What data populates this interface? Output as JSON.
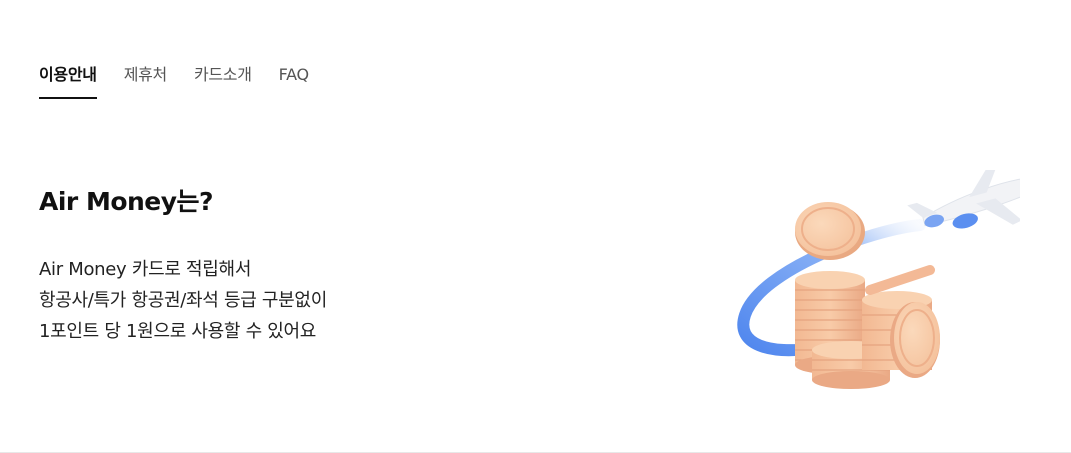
{
  "tabs": [
    {
      "label": "이용안내",
      "active": true
    },
    {
      "label": "제휴처",
      "active": false
    },
    {
      "label": "카드소개",
      "active": false
    },
    {
      "label": "FAQ",
      "active": false
    }
  ],
  "main": {
    "title": "Air Money는?",
    "description": [
      "Air Money 카드로 적립해서",
      "항공사/특가 항공권/좌석 등급 구분없이",
      "1포인트 당 1원으로 사용할 수 있어요"
    ]
  },
  "illustration": {
    "icons": [
      "airplane-icon",
      "coin-stack-icon"
    ],
    "colors": {
      "coin": "#f7c9a2",
      "coin_edge": "#e9a982",
      "trail": "#6f9cf0",
      "plane": "#f2f3f6"
    }
  }
}
